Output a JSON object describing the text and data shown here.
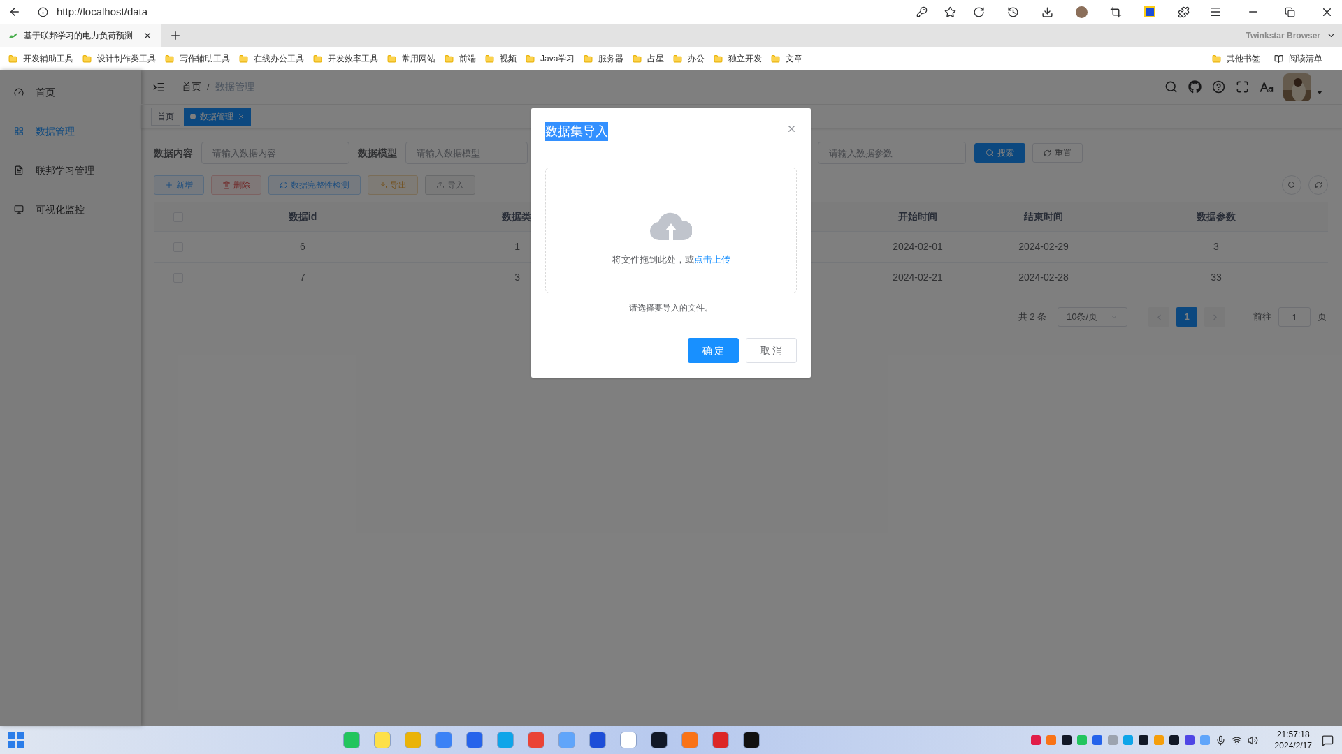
{
  "browser": {
    "url": "http://localhost/data",
    "tab": {
      "title": "基于联邦学习的电力负荷预测"
    },
    "brand": "Twinkstar Browser",
    "bookmarks": [
      "开发辅助工具",
      "设计制作类工具",
      "写作辅助工具",
      "在线办公工具",
      "开发效率工具",
      "常用网站",
      "前端",
      "视频",
      "Java学习",
      "服务器",
      "占星",
      "办公",
      "独立开发",
      "文章"
    ],
    "other_bookmarks": "其他书签",
    "reading_list": "阅读清单"
  },
  "sidebar": {
    "items": [
      {
        "label": "首页",
        "selected": false,
        "kind": "dashboard"
      },
      {
        "label": "数据管理",
        "selected": true,
        "kind": "grid"
      },
      {
        "label": "联邦学习管理",
        "selected": false,
        "kind": "doc"
      },
      {
        "label": "可视化监控",
        "selected": false,
        "kind": "monitor"
      }
    ]
  },
  "header": {
    "breadcrumb": [
      "首页",
      "数据管理"
    ],
    "separator": "/"
  },
  "tags": [
    {
      "label": "首页",
      "selected": false
    },
    {
      "label": "数据管理",
      "selected": true
    }
  ],
  "search_form": {
    "fields": [
      {
        "label": "数据内容",
        "placeholder": "请输入数据内容"
      },
      {
        "label": "数据模型",
        "placeholder": "请输入数据模型"
      },
      {
        "placeholder": "请输入数据参数"
      }
    ],
    "buttons": [
      {
        "label": "搜索",
        "kind": "primary"
      },
      {
        "label": "重置",
        "kind": "default"
      }
    ]
  },
  "toolbar": {
    "buttons": [
      {
        "label": "新增",
        "kind": "primary"
      },
      {
        "label": "删除",
        "kind": "danger"
      },
      {
        "label": "数据完整性检测",
        "kind": "primary"
      },
      {
        "label": "导出",
        "kind": "warning"
      },
      {
        "label": "导入",
        "kind": "info"
      }
    ]
  },
  "table": {
    "columns": [
      "数据id",
      "数据类",
      "开始时间",
      "结束时间",
      "数据参数"
    ],
    "header_checked": false,
    "rows": [
      {
        "checked": false,
        "cells": [
          "6",
          "1",
          "2024-02-01",
          "2024-02-29",
          "3"
        ]
      },
      {
        "checked": false,
        "cells": [
          "7",
          "3",
          "2024-02-21",
          "2024-02-28",
          "33"
        ]
      }
    ]
  },
  "pagination": {
    "total": "共 2 条",
    "page_size": "10条/页",
    "pages": [
      {
        "label": "1",
        "selected": true
      }
    ],
    "goto_label": "前往",
    "goto_value": "1",
    "page_suffix": "页"
  },
  "dialog": {
    "title": "数据集导入",
    "title_highlighted": true,
    "drop_text": "将文件拖到此处，或",
    "drop_link": "点击上传",
    "tip": "请选择要导入的文件。",
    "buttons": [
      {
        "label": "确 定",
        "kind": "primary"
      },
      {
        "label": "取 消",
        "kind": "default"
      }
    ]
  },
  "taskbar": {
    "time": "21:57:18",
    "date": "2024/2/17"
  }
}
